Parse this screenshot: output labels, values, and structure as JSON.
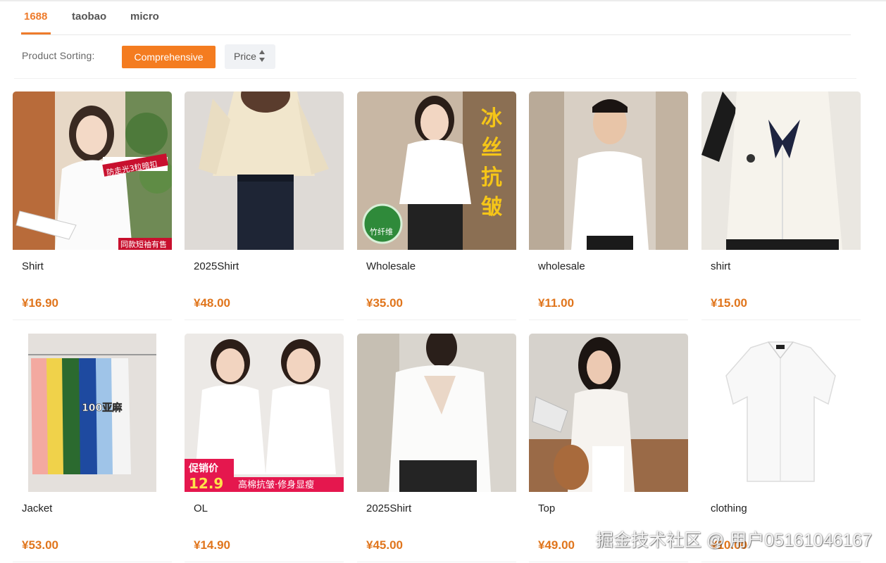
{
  "tabs": [
    {
      "label": "1688",
      "active": true
    },
    {
      "label": "taobao",
      "active": false
    },
    {
      "label": "micro",
      "active": false
    }
  ],
  "sorting": {
    "label": "Product Sorting:",
    "comprehensive_label": "Comprehensive",
    "price_label": "Price"
  },
  "products": [
    {
      "title": "Shirt",
      "price": "¥16.90",
      "overlay": [
        "防走光3粒暗扣",
        "同款短袖有售"
      ]
    },
    {
      "title": "2025Shirt",
      "price": "¥48.00",
      "overlay": []
    },
    {
      "title": "Wholesale",
      "price": "¥35.00",
      "overlay": [
        "冰",
        "丝",
        "抗",
        "皱",
        "竹纤维"
      ]
    },
    {
      "title": "wholesale",
      "price": "¥11.00",
      "overlay": []
    },
    {
      "title": "shirt",
      "price": "¥15.00",
      "overlay": []
    },
    {
      "title": "Jacket",
      "price": "¥53.00",
      "overlay": [
        "100亚麻"
      ]
    },
    {
      "title": "OL",
      "price": "¥14.90",
      "overlay": [
        "促销价",
        "12.9",
        "高棉抗皱·修身显瘦"
      ]
    },
    {
      "title": "2025Shirt",
      "price": "¥45.00",
      "overlay": []
    },
    {
      "title": "Top",
      "price": "¥49.00",
      "overlay": []
    },
    {
      "title": "clothing",
      "price": "¥10.00",
      "overlay": []
    }
  ],
  "watermark": "掘金技术社区 @ 用户05161046167",
  "colors": {
    "accent": "#f47c20",
    "price": "#e0751c"
  }
}
